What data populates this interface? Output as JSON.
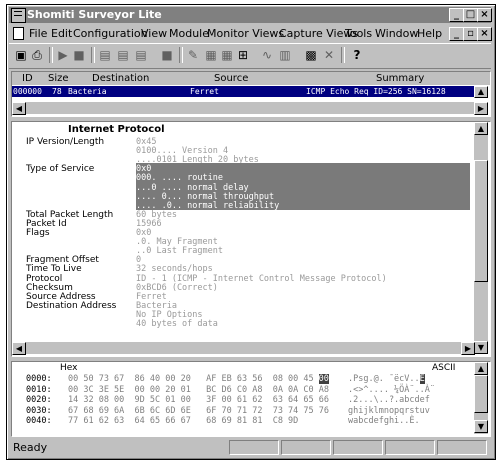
{
  "window": {
    "title": "Shomiti Surveyor Lite"
  },
  "title_buttons": {
    "minimize": "_",
    "maximize": "□",
    "close": "×"
  },
  "doc_buttons": {
    "minimize": "_",
    "restore": "▫",
    "close": "×"
  },
  "menu": [
    "File",
    "Edit",
    "Configuration",
    "View",
    "Module",
    "Monitor Views",
    "Capture Views",
    "Tools",
    "Window",
    "Help"
  ],
  "toolbar": {
    "help_glyph": "?"
  },
  "packet_list": {
    "columns": [
      "ID",
      "Size",
      "Destination",
      "Source",
      "Summary"
    ],
    "row": {
      "id": "000000",
      "size": "78",
      "destination": "Bacteria",
      "source": "Ferret",
      "summary": "ICMP Echo Req  ID=256 SN=16128"
    }
  },
  "decode": {
    "section": "Internet Protocol",
    "fields": [
      {
        "label": "IP Version/Length",
        "lines": [
          "0x45",
          "   0100....   Version 4",
          "   ....0101   Length 20 bytes"
        ],
        "highlight": false
      },
      {
        "label": "Type of Service",
        "lines": [
          "0x0",
          "   000. ....   routine",
          "   ...0 ....   normal delay",
          "   .... 0...   normal throughput",
          "   .... .0..   normal reliability"
        ],
        "highlight": true
      },
      {
        "label": "Total Packet Length",
        "lines": [
          " 60 bytes"
        ],
        "highlight": false
      },
      {
        "label": "Packet Id",
        "lines": [
          " 15966"
        ],
        "highlight": false
      },
      {
        "label": "Flags",
        "lines": [
          " 0x0",
          "   .0.  May Fragment",
          "   ..0  Last Fragment"
        ],
        "highlight": false
      },
      {
        "label": "Fragment Offset",
        "lines": [
          "0"
        ],
        "highlight": false
      },
      {
        "label": "Time To Live",
        "lines": [
          " 32 seconds/hops"
        ],
        "highlight": false
      },
      {
        "label": "Protocol",
        "lines": [
          " ID - 1 (ICMP - Internet Control Message Protocol)"
        ],
        "highlight": false
      },
      {
        "label": "Checksum",
        "lines": [
          "0xBCD6 (Correct)"
        ],
        "highlight": false
      },
      {
        "label": "Source Address",
        "lines": [
          " Ferret"
        ],
        "highlight": false
      },
      {
        "label": "Destination Address",
        "lines": [
          " Bacteria"
        ],
        "highlight": false
      },
      {
        "label": "",
        "lines": [
          "No IP Options"
        ],
        "highlight": false
      },
      {
        "label": "",
        "lines": [
          "40 bytes of data"
        ],
        "highlight": false
      }
    ]
  },
  "hex": {
    "header_left": "Hex",
    "header_right": "ASCII",
    "rows": [
      {
        "offset": "0000:",
        "bytes": "00 50 73 67  86 40 00 20   AF EB 63 56  08 00 45",
        "hl": "00",
        "ascii": ".Psg.@. ¯ëcV..",
        "ascii_hl": "E"
      },
      {
        "offset": "0010:",
        "bytes": "00 3C 3E 5E  00 00 20 01   BC D6 C0 A8  0A 0A C0 A8",
        "hl": "",
        "ascii": ".<>^.... ¼ÖÀ¨..À¨",
        "ascii_hl": ""
      },
      {
        "offset": "0020:",
        "bytes": "14 32 08 00  9D 5C 01 00   3F 00 61 62  63 64 65 66",
        "hl": "",
        "ascii": ".2...\\..?.abcdef",
        "ascii_hl": ""
      },
      {
        "offset": "0030:",
        "bytes": "67 68 69 6A  6B 6C 6D 6E   6F 70 71 72  73 74 75 76",
        "hl": "",
        "ascii": "ghijklmnopqrstuv",
        "ascii_hl": ""
      },
      {
        "offset": "0040:",
        "bytes": "77 61 62 63  64 65 66 67   68 69 81 81  C8 9D",
        "hl": "",
        "ascii": "wabcdefghi..È.",
        "ascii_hl": ""
      }
    ]
  },
  "status": {
    "text": "Ready"
  }
}
